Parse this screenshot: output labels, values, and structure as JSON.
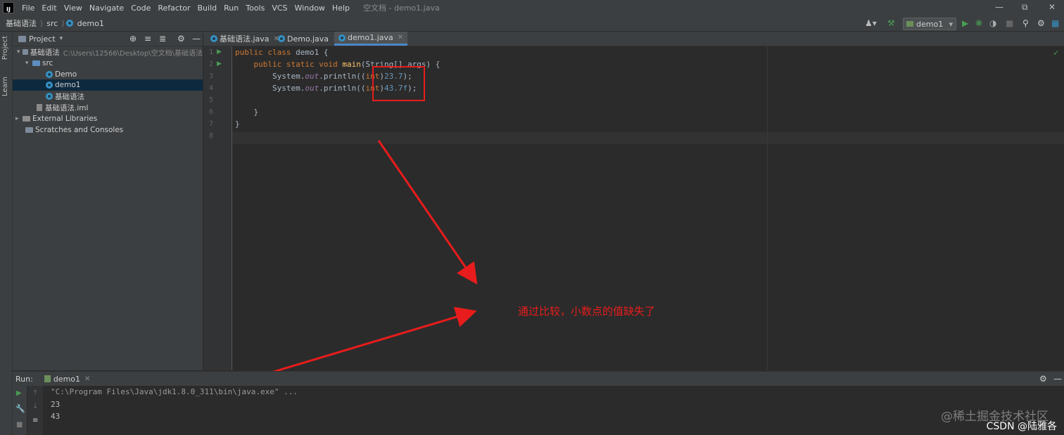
{
  "menu": {
    "logo": "IJ",
    "items": [
      "File",
      "Edit",
      "View",
      "Navigate",
      "Code",
      "Refactor",
      "Build",
      "Run",
      "Tools",
      "VCS",
      "Window",
      "Help"
    ],
    "window_title": "空文档 - demo1.java"
  },
  "breadcrumbs": [
    "基础语法",
    "src",
    "demo1"
  ],
  "run_config": "demo1",
  "stripe": {
    "project": "Project",
    "learn": "Learn"
  },
  "project_panel": {
    "title": "Project",
    "tree": {
      "root": "基础语法",
      "root_path": "C:\\Users\\12566\\Desktop\\空文档\\基础语法",
      "src": "src",
      "files": [
        "Demo",
        "demo1",
        "基础语法"
      ],
      "iml": "基础语法.iml",
      "external": "External Libraries",
      "scratches": "Scratches and Consoles"
    }
  },
  "tabs": [
    {
      "label": "基础语法.java"
    },
    {
      "label": "Demo.java"
    },
    {
      "label": "demo1.java"
    }
  ],
  "editor": {
    "line_numbers": [
      "1",
      "2",
      "3",
      "4",
      "5",
      "6",
      "7",
      "8"
    ],
    "code": {
      "l1_kw": "public class ",
      "l1_rest": "demo1 {",
      "l2_kw": "    public static void ",
      "l2_fn": "main",
      "l2_rest": "(String[] args) {",
      "l3_a": "        System.",
      "l3_out": "out",
      "l3_b": ".println((",
      "l3_kw": "int",
      "l3_c": ")",
      "l3_num": "23.7",
      "l3_d": ");",
      "l4_num": "43.7f",
      "l6": "    }",
      "l7": "}"
    }
  },
  "annotation": "通过比较，小数点的值缺失了",
  "run_panel": {
    "label": "Run:",
    "tab": "demo1",
    "command": "\"C:\\Program Files\\Java\\jdk1.8.0_311\\bin\\java.exe\" ...",
    "output": [
      "23",
      "43"
    ]
  },
  "watermark": {
    "line1": "@稀土掘金技术社区",
    "line2": "CSDN @陆雅各"
  },
  "colors": {
    "keyword": "#cc7832",
    "number": "#6897bb",
    "function": "#ffc66d",
    "annotation_red": "#e81c1c",
    "selection": "#0d293e"
  }
}
